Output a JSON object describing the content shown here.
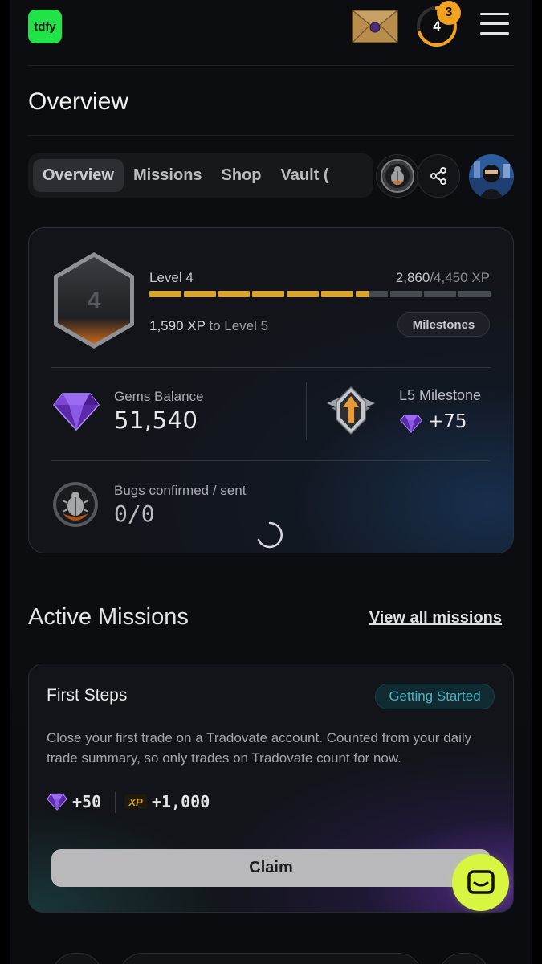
{
  "header": {
    "logo_text": "tdfy",
    "level": "4",
    "notification_count": "3"
  },
  "page_title": "Overview",
  "tabs": [
    {
      "label": "Overview",
      "active": true
    },
    {
      "label": "Missions",
      "active": false
    },
    {
      "label": "Shop",
      "active": false
    },
    {
      "label": "Vault (",
      "active": false
    }
  ],
  "overview": {
    "level_badge": "4",
    "level_label": "Level 4",
    "xp_current": "2,860",
    "xp_max": "/4,450 XP",
    "xp_progress": 0.64,
    "xp_to_value": "1,590 XP",
    "xp_to_text": "to Level 5",
    "milestones_label": "Milestones",
    "gems_label": "Gems Balance",
    "gems_value": "51,540",
    "milestone_label": "L5 Milestone",
    "milestone_value": "+75",
    "bugs_label": "Bugs confirmed / sent",
    "bugs_value": "0/0"
  },
  "missions": {
    "section_title": "Active Missions",
    "view_all": "View all missions",
    "items": [
      {
        "title": "First Steps",
        "tag": "Getting Started",
        "description": "Close your first trade on a Tradovate account. Counted from your daily trade summary, so only trades on Tradovate count for now.",
        "gems_reward": "+50",
        "xp_icon_text": "XP",
        "xp_reward": "+1,000",
        "button": "Claim"
      }
    ]
  },
  "colors": {
    "accent_green": "#22e24a",
    "xp_gold": "#d7a431",
    "notification_orange": "#f2a21e",
    "tag_teal": "#49b3c3",
    "chat_yellow": "#d8f541"
  }
}
